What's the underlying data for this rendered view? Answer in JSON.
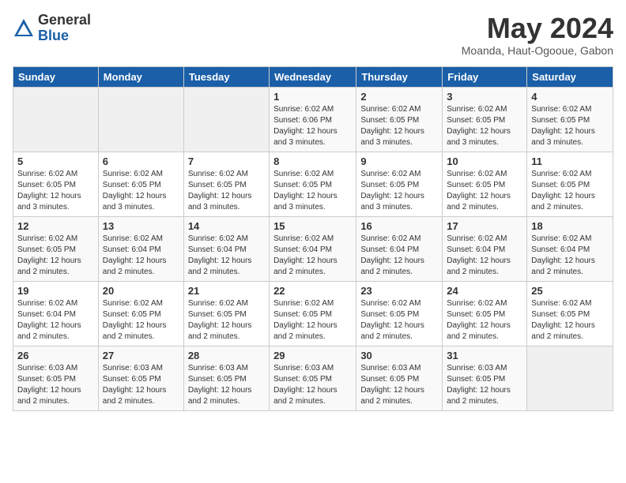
{
  "header": {
    "logo_general": "General",
    "logo_blue": "Blue",
    "month_title": "May 2024",
    "location": "Moanda, Haut-Ogooue, Gabon"
  },
  "days_of_week": [
    "Sunday",
    "Monday",
    "Tuesday",
    "Wednesday",
    "Thursday",
    "Friday",
    "Saturday"
  ],
  "weeks": [
    [
      {
        "day": "",
        "info": ""
      },
      {
        "day": "",
        "info": ""
      },
      {
        "day": "",
        "info": ""
      },
      {
        "day": "1",
        "info": "Sunrise: 6:02 AM\nSunset: 6:06 PM\nDaylight: 12 hours\nand 3 minutes."
      },
      {
        "day": "2",
        "info": "Sunrise: 6:02 AM\nSunset: 6:05 PM\nDaylight: 12 hours\nand 3 minutes."
      },
      {
        "day": "3",
        "info": "Sunrise: 6:02 AM\nSunset: 6:05 PM\nDaylight: 12 hours\nand 3 minutes."
      },
      {
        "day": "4",
        "info": "Sunrise: 6:02 AM\nSunset: 6:05 PM\nDaylight: 12 hours\nand 3 minutes."
      }
    ],
    [
      {
        "day": "5",
        "info": "Sunrise: 6:02 AM\nSunset: 6:05 PM\nDaylight: 12 hours\nand 3 minutes."
      },
      {
        "day": "6",
        "info": "Sunrise: 6:02 AM\nSunset: 6:05 PM\nDaylight: 12 hours\nand 3 minutes."
      },
      {
        "day": "7",
        "info": "Sunrise: 6:02 AM\nSunset: 6:05 PM\nDaylight: 12 hours\nand 3 minutes."
      },
      {
        "day": "8",
        "info": "Sunrise: 6:02 AM\nSunset: 6:05 PM\nDaylight: 12 hours\nand 3 minutes."
      },
      {
        "day": "9",
        "info": "Sunrise: 6:02 AM\nSunset: 6:05 PM\nDaylight: 12 hours\nand 3 minutes."
      },
      {
        "day": "10",
        "info": "Sunrise: 6:02 AM\nSunset: 6:05 PM\nDaylight: 12 hours\nand 2 minutes."
      },
      {
        "day": "11",
        "info": "Sunrise: 6:02 AM\nSunset: 6:05 PM\nDaylight: 12 hours\nand 2 minutes."
      }
    ],
    [
      {
        "day": "12",
        "info": "Sunrise: 6:02 AM\nSunset: 6:05 PM\nDaylight: 12 hours\nand 2 minutes."
      },
      {
        "day": "13",
        "info": "Sunrise: 6:02 AM\nSunset: 6:04 PM\nDaylight: 12 hours\nand 2 minutes."
      },
      {
        "day": "14",
        "info": "Sunrise: 6:02 AM\nSunset: 6:04 PM\nDaylight: 12 hours\nand 2 minutes."
      },
      {
        "day": "15",
        "info": "Sunrise: 6:02 AM\nSunset: 6:04 PM\nDaylight: 12 hours\nand 2 minutes."
      },
      {
        "day": "16",
        "info": "Sunrise: 6:02 AM\nSunset: 6:04 PM\nDaylight: 12 hours\nand 2 minutes."
      },
      {
        "day": "17",
        "info": "Sunrise: 6:02 AM\nSunset: 6:04 PM\nDaylight: 12 hours\nand 2 minutes."
      },
      {
        "day": "18",
        "info": "Sunrise: 6:02 AM\nSunset: 6:04 PM\nDaylight: 12 hours\nand 2 minutes."
      }
    ],
    [
      {
        "day": "19",
        "info": "Sunrise: 6:02 AM\nSunset: 6:04 PM\nDaylight: 12 hours\nand 2 minutes."
      },
      {
        "day": "20",
        "info": "Sunrise: 6:02 AM\nSunset: 6:05 PM\nDaylight: 12 hours\nand 2 minutes."
      },
      {
        "day": "21",
        "info": "Sunrise: 6:02 AM\nSunset: 6:05 PM\nDaylight: 12 hours\nand 2 minutes."
      },
      {
        "day": "22",
        "info": "Sunrise: 6:02 AM\nSunset: 6:05 PM\nDaylight: 12 hours\nand 2 minutes."
      },
      {
        "day": "23",
        "info": "Sunrise: 6:02 AM\nSunset: 6:05 PM\nDaylight: 12 hours\nand 2 minutes."
      },
      {
        "day": "24",
        "info": "Sunrise: 6:02 AM\nSunset: 6:05 PM\nDaylight: 12 hours\nand 2 minutes."
      },
      {
        "day": "25",
        "info": "Sunrise: 6:02 AM\nSunset: 6:05 PM\nDaylight: 12 hours\nand 2 minutes."
      }
    ],
    [
      {
        "day": "26",
        "info": "Sunrise: 6:03 AM\nSunset: 6:05 PM\nDaylight: 12 hours\nand 2 minutes."
      },
      {
        "day": "27",
        "info": "Sunrise: 6:03 AM\nSunset: 6:05 PM\nDaylight: 12 hours\nand 2 minutes."
      },
      {
        "day": "28",
        "info": "Sunrise: 6:03 AM\nSunset: 6:05 PM\nDaylight: 12 hours\nand 2 minutes."
      },
      {
        "day": "29",
        "info": "Sunrise: 6:03 AM\nSunset: 6:05 PM\nDaylight: 12 hours\nand 2 minutes."
      },
      {
        "day": "30",
        "info": "Sunrise: 6:03 AM\nSunset: 6:05 PM\nDaylight: 12 hours\nand 2 minutes."
      },
      {
        "day": "31",
        "info": "Sunrise: 6:03 AM\nSunset: 6:05 PM\nDaylight: 12 hours\nand 2 minutes."
      },
      {
        "day": "",
        "info": ""
      }
    ]
  ]
}
